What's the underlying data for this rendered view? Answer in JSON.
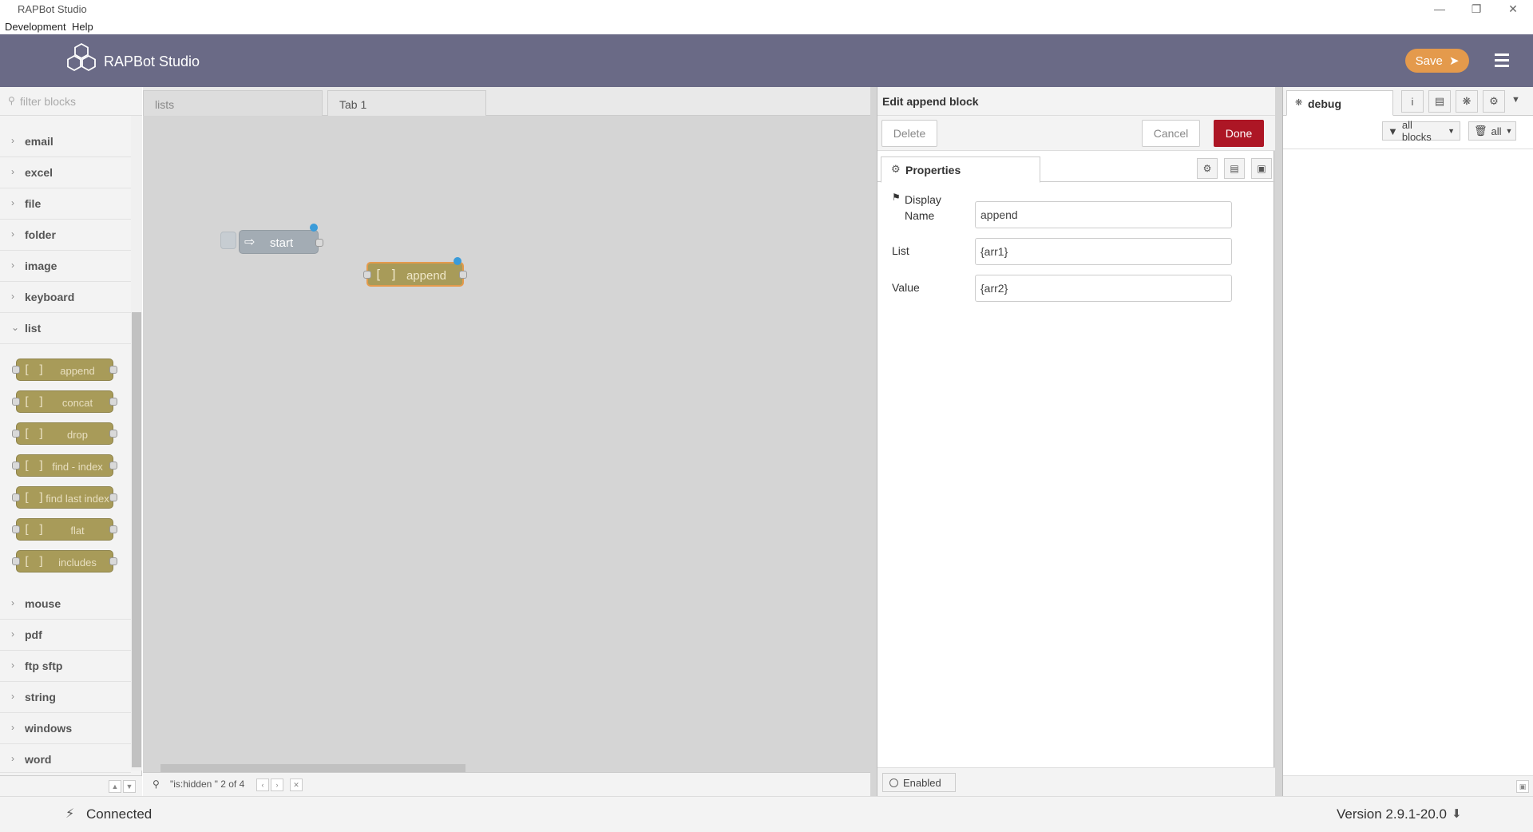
{
  "window": {
    "title": "RAPBot Studio",
    "menu": [
      "Development",
      "Help"
    ]
  },
  "header": {
    "app_title": "RAPBot Studio",
    "save_label": "Save"
  },
  "palette": {
    "filter_placeholder": "filter blocks",
    "categories_top": [
      "email",
      "excel",
      "file",
      "folder",
      "image",
      "keyboard"
    ],
    "open_category": "list",
    "list_blocks": [
      "append",
      "concat",
      "drop",
      "find - index",
      "find last index",
      "flat",
      "includes"
    ],
    "categories_bottom": [
      "mouse",
      "pdf",
      "ftp sftp",
      "string",
      "windows",
      "word"
    ]
  },
  "workspace": {
    "tabs": [
      "lists",
      "Tab 1"
    ],
    "active_tab": "Tab 1",
    "nodes": {
      "start": "start",
      "append": "append"
    },
    "search_text": "\"is:hidden \" 2 of 4"
  },
  "editor": {
    "title": "Edit append block",
    "delete_label": "Delete",
    "cancel_label": "Cancel",
    "done_label": "Done",
    "properties_tab": "Properties",
    "fields": {
      "display_name_label": "Display Name",
      "display_name_value": "append",
      "list_label": "List",
      "list_value": "{arr1}",
      "value_label": "Value",
      "value_value": "{arr2}"
    },
    "enabled_label": "Enabled"
  },
  "sidebar": {
    "debug_tab": "debug",
    "filter_blocks": "all blocks",
    "clear_label": "all"
  },
  "status": {
    "connection": "Connected",
    "version": "Version 2.9.1-20.0"
  },
  "colors": {
    "header": "#6a6a86",
    "save": "#e49a4c",
    "done": "#ad1625",
    "list_block": "#a89b59",
    "start_node": "#a3acb4"
  }
}
